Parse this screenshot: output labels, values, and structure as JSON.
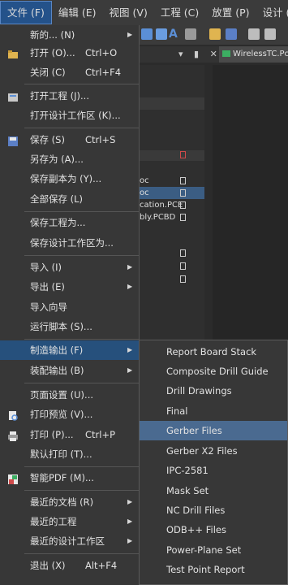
{
  "menubar": {
    "items": [
      "文件 (F)",
      "编辑 (E)",
      "视图 (V)",
      "工程 (C)",
      "放置 (P)",
      "设计 (D)"
    ]
  },
  "document_tab": {
    "label": "WirelessTC.Pc"
  },
  "panel_controls": "▾ ▮ ✕",
  "project_rows": [
    "oc",
    "oc",
    "cation.PCE",
    "bly.PCBD"
  ],
  "file_menu": {
    "items": [
      {
        "label": "新的... (N)",
        "submenu": true
      },
      {
        "label": "打开 (O)...",
        "shortcut": "Ctrl+O"
      },
      {
        "label": "关闭 (C)",
        "shortcut": "Ctrl+F4"
      },
      {
        "label": "打开工程 (J)..."
      },
      {
        "label": "打开设计工作区 (K)..."
      },
      {
        "label": "保存 (S)",
        "shortcut": "Ctrl+S"
      },
      {
        "label": "另存为 (A)..."
      },
      {
        "label": "保存副本为 (Y)..."
      },
      {
        "label": "全部保存 (L)"
      },
      {
        "label": "保存工程为..."
      },
      {
        "label": "保存设计工作区为..."
      },
      {
        "label": "导入 (I)",
        "submenu": true
      },
      {
        "label": "导出 (E)",
        "submenu": true
      },
      {
        "label": "导入向导"
      },
      {
        "label": "运行脚本 (S)..."
      },
      {
        "label": "制造输出 (F)",
        "submenu": true
      },
      {
        "label": "装配输出 (B)",
        "submenu": true
      },
      {
        "label": "页面设置 (U)..."
      },
      {
        "label": "打印预览 (V)..."
      },
      {
        "label": "打印 (P)...",
        "shortcut": "Ctrl+P"
      },
      {
        "label": "默认打印 (T)..."
      },
      {
        "label": "智能PDF (M)..."
      },
      {
        "label": "最近的文档 (R)",
        "submenu": true
      },
      {
        "label": "最近的工程",
        "submenu": true
      },
      {
        "label": "最近的设计工作区",
        "submenu": true
      },
      {
        "label": "退出 (X)",
        "shortcut": "Alt+F4"
      }
    ]
  },
  "fabrication_submenu": {
    "items": [
      "Report Board Stack",
      "Composite Drill Guide",
      "Drill Drawings",
      "Final",
      "Gerber Files",
      "Gerber X2 Files",
      "IPC-2581",
      "Mask Set",
      "NC Drill Files",
      "ODB++ Files",
      "Power-Plane Set",
      "Test Point Report"
    ],
    "highlighted": "Gerber Files"
  },
  "colors": {
    "menu_bg": "#373737",
    "highlight": "#26507c",
    "submenu_highlight": "#4a6a90",
    "menubar_bg": "#3b3b3b"
  }
}
